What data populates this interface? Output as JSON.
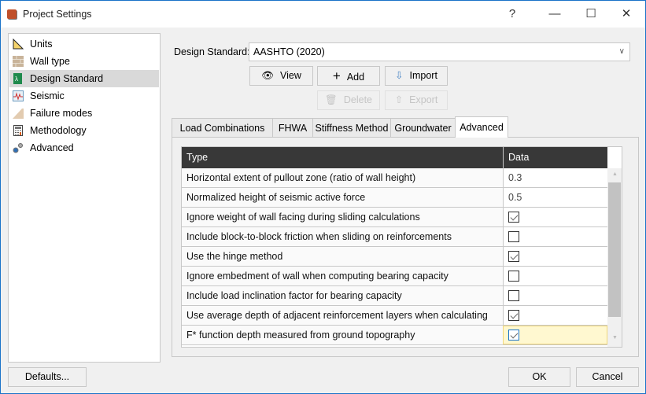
{
  "window": {
    "title": "Project Settings",
    "help": "?",
    "minimize": "—",
    "maximize": "☐",
    "close": "✕",
    "accent": "#1a73c8"
  },
  "sidebar": {
    "items": [
      {
        "label": "Units",
        "icon": "triangle-ruler-icon"
      },
      {
        "label": "Wall type",
        "icon": "brick-wall-icon"
      },
      {
        "label": "Design Standard",
        "icon": "design-standard-icon",
        "selected": true
      },
      {
        "label": "Seismic",
        "icon": "seismograph-icon"
      },
      {
        "label": "Failure modes",
        "icon": "slope-icon"
      },
      {
        "label": "Methodology",
        "icon": "calculator-icon"
      },
      {
        "label": "Advanced",
        "icon": "gears-icon"
      }
    ]
  },
  "design_standard": {
    "label": "Design Standard:",
    "value": "AASHTO (2020)"
  },
  "buttons": {
    "view": "View",
    "add": "Add",
    "import": "Import",
    "delete": "Delete",
    "export": "Export",
    "defaults": "Defaults...",
    "ok": "OK",
    "cancel": "Cancel"
  },
  "tabs": [
    {
      "label": "Load Combinations"
    },
    {
      "label": "FHWA"
    },
    {
      "label": "Stiffness Method"
    },
    {
      "label": "Groundwater"
    },
    {
      "label": "Advanced",
      "active": true
    }
  ],
  "table": {
    "headers": [
      "Type",
      "Data"
    ],
    "rows": [
      {
        "type": "Horizontal extent of pullout zone (ratio of wall height)",
        "value": "0.3"
      },
      {
        "type": "Normalized height of seismic active force",
        "value": "0.5"
      },
      {
        "type": "Ignore weight of wall facing during sliding calculations",
        "checked": true
      },
      {
        "type": "Include block-to-block friction when sliding on reinforcements",
        "checked": false
      },
      {
        "type": "Use the hinge method",
        "checked": true
      },
      {
        "type": "Ignore embedment of wall when computing bearing capacity",
        "checked": false
      },
      {
        "type": "Include load inclination factor for bearing capacity",
        "checked": false
      },
      {
        "type": "Use average depth of adjacent reinforcement layers when calculating Tmax",
        "checked": true
      },
      {
        "type": "F* function depth measured from ground topography",
        "checked": true,
        "selected": true
      }
    ]
  }
}
